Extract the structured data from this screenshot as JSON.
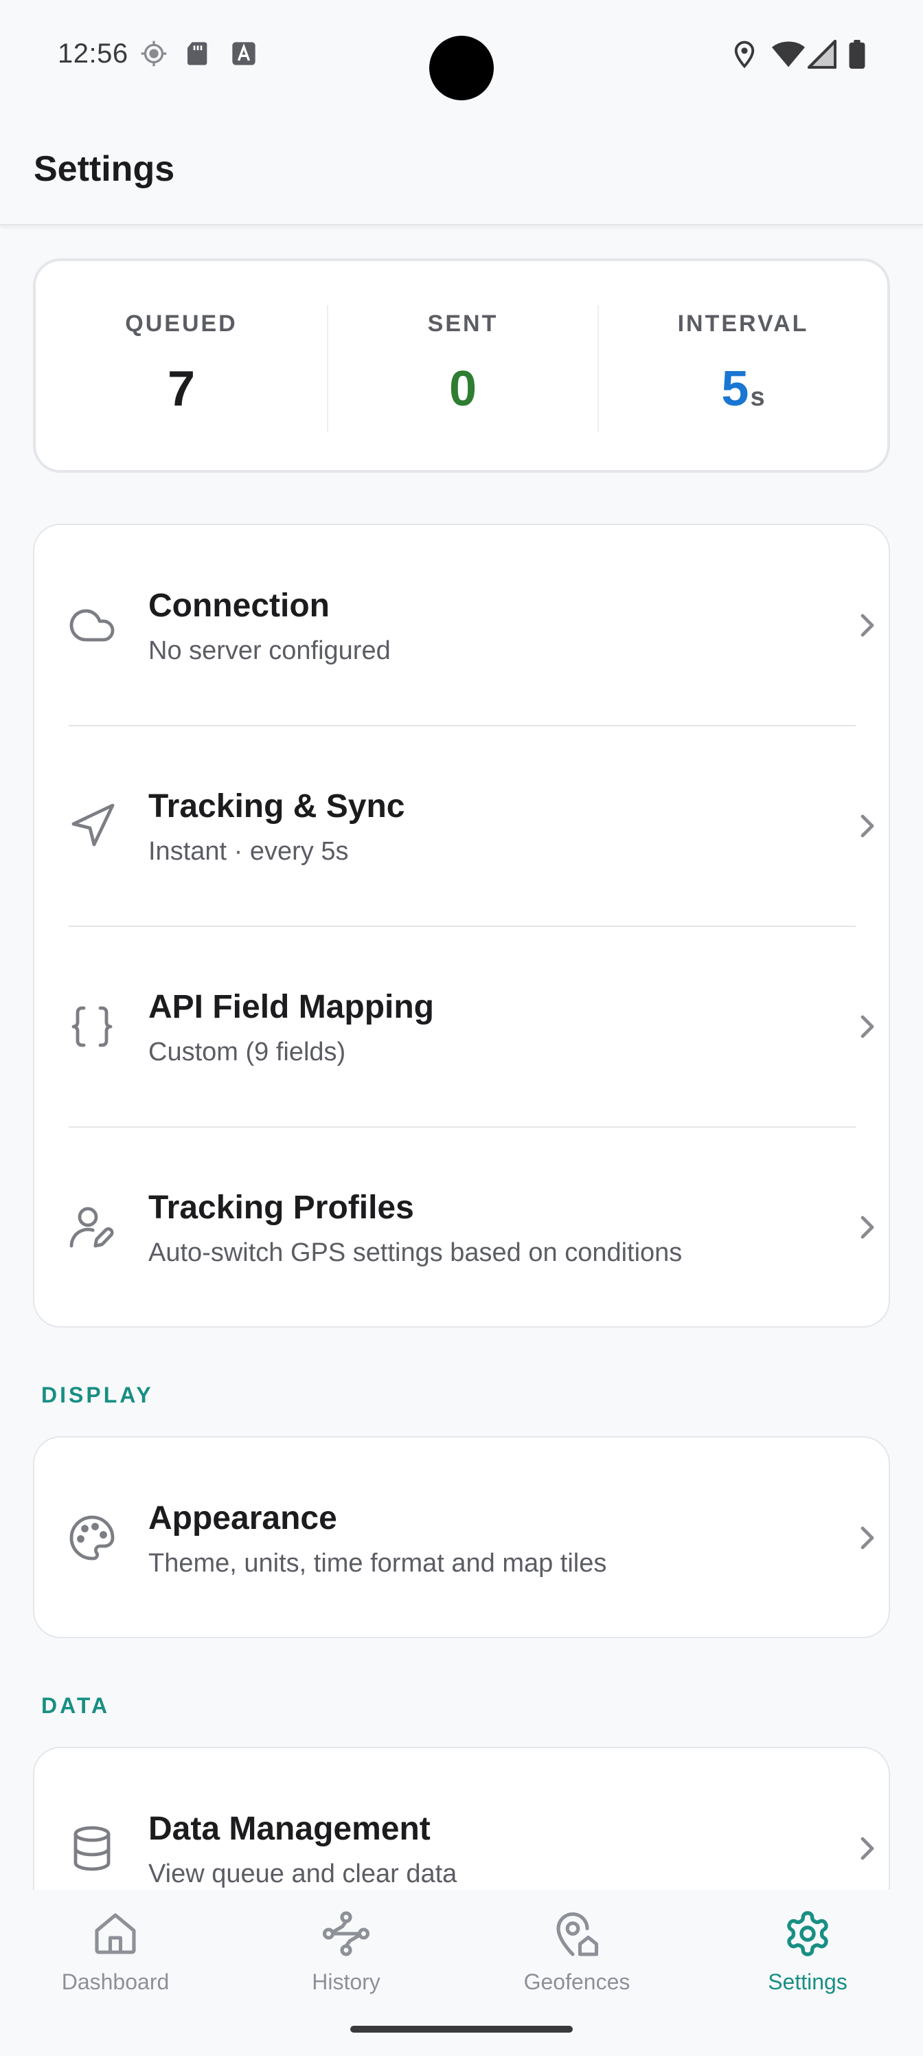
{
  "status_bar": {
    "time": "12:56",
    "left_icons": [
      "location-target-icon",
      "sd-card-icon",
      "keyboard-a-icon"
    ],
    "right_icons": [
      "location-pin-icon",
      "wifi-icon",
      "cell-signal-icon",
      "battery-icon"
    ]
  },
  "app_bar": {
    "title": "Settings"
  },
  "stats": {
    "queued_label": "QUEUED",
    "queued_value": "7",
    "sent_label": "SENT",
    "sent_value": "0",
    "interval_label": "INTERVAL",
    "interval_value": "5",
    "interval_unit": "s",
    "colors": {
      "queued": "#1c1c1e",
      "sent": "#2e7d32",
      "interval": "#1976d2"
    }
  },
  "main_menu": [
    {
      "icon": "cloud-icon",
      "title": "Connection",
      "subtitle": "No server configured"
    },
    {
      "icon": "navigation-arrow-icon",
      "title": "Tracking & Sync",
      "subtitle": "Instant · every 5s"
    },
    {
      "icon": "braces-icon",
      "title": "API Field Mapping",
      "subtitle": "Custom (9 fields)"
    },
    {
      "icon": "user-pen-icon",
      "title": "Tracking Profiles",
      "subtitle": "Auto-switch GPS settings based on conditions"
    }
  ],
  "display_section": {
    "label": "DISPLAY",
    "items": [
      {
        "icon": "palette-icon",
        "title": "Appearance",
        "subtitle": "Theme, units, time format and map tiles"
      }
    ]
  },
  "data_section": {
    "label": "DATA",
    "items": [
      {
        "icon": "database-icon",
        "title": "Data Management",
        "subtitle": "View queue and clear data"
      }
    ]
  },
  "bottom_nav": {
    "active": "Settings",
    "accent_color": "#188f83",
    "items": [
      {
        "icon": "home-icon",
        "label": "Dashboard"
      },
      {
        "icon": "route-icon",
        "label": "History"
      },
      {
        "icon": "geofence-pin-icon",
        "label": "Geofences"
      },
      {
        "icon": "gear-icon",
        "label": "Settings"
      }
    ]
  }
}
